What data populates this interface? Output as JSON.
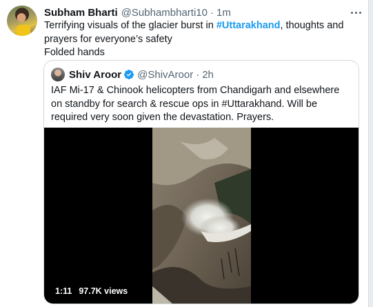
{
  "tweet": {
    "author_name": "Subham Bharti",
    "author_handle": "@Subhambharti10",
    "separator": "·",
    "time": "1m",
    "text_before": "Terrifying visuals of the glacier burst in ",
    "hashtag": "#Uttarakhand",
    "text_after": ", thoughts and prayers for everyone’s safety",
    "text_line2": "Folded hands"
  },
  "quoted_tweet": {
    "author_name": "Shiv Aroor",
    "author_handle": "@ShivAroor",
    "separator": "·",
    "time": "2h",
    "text": "IAF Mi-17 & Chinook helicopters from Chandigarh and elsewhere on standby for search & rescue ops in #Uttarakhand. Will be required very soon given the devastation. Prayers.",
    "video": {
      "duration": "1:11",
      "views": "97.7K views"
    }
  },
  "colors": {
    "accent": "#1d9bf0",
    "text_primary": "#0f1419",
    "text_secondary": "#536471",
    "border": "#cfd9de"
  },
  "icons": [
    "more-options-icon",
    "verified-badge-icon"
  ]
}
